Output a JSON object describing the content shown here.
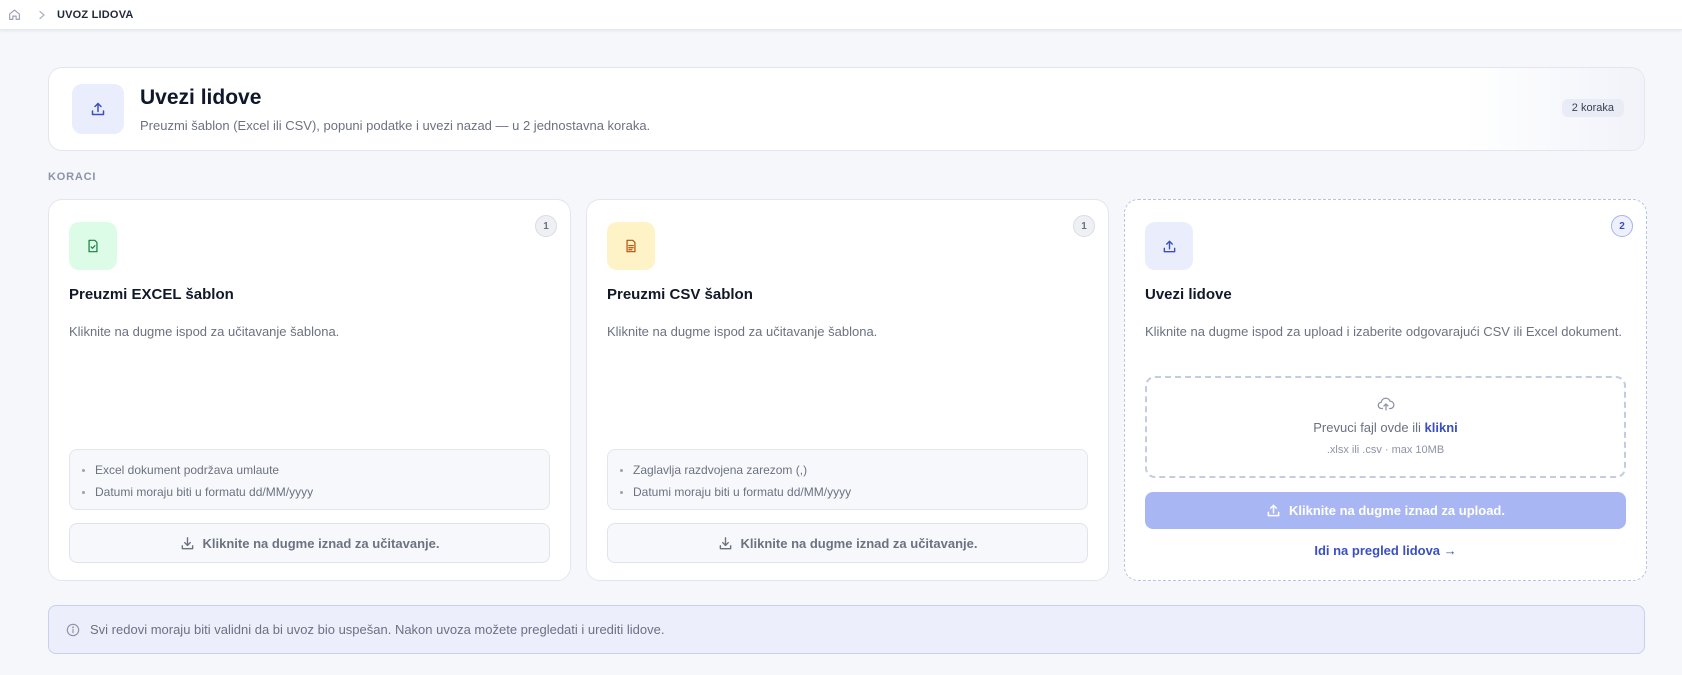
{
  "breadcrumb": {
    "home_icon": "home-icon",
    "separator_icon": "chevron-right-icon",
    "current": "UVOZ LIDOVA"
  },
  "hero": {
    "icon": "upload-icon",
    "title": "Uvezi lidove",
    "subtitle": "Preuzmi šablon (Excel ili CSV), popuni podatke i uvezi nazad — u 2 jednostavna koraka.",
    "badge": "2 koraka"
  },
  "section_label": "KORACI",
  "cards": [
    {
      "step": "1",
      "icon": "file-check-icon",
      "title": "Preuzmi EXCEL šablon",
      "description": "Kliknite na dugme ispod za učitavanje šablona.",
      "notes": [
        "Excel dokument podržava umlaute",
        "Datumi moraju biti u formatu dd/MM/yyyy"
      ],
      "button": "Kliknite na dugme iznad za učitavanje."
    },
    {
      "step": "1",
      "icon": "file-text-icon",
      "title": "Preuzmi CSV šablon",
      "description": "Kliknite na dugme ispod za učitavanje šablona.",
      "notes": [
        "Zaglavlja razdvojena zarezom (,)",
        "Datumi moraju biti u formatu dd/MM/yyyy"
      ],
      "button": "Kliknite na dugme iznad za učitavanje."
    },
    {
      "step": "2",
      "icon": "upload-icon",
      "title": "Uvezi lidove",
      "description": "Kliknite na dugme ispod za upload i izaberite odgovarajući CSV ili Excel dokument.",
      "dropzone": {
        "icon": "cloud-upload-icon",
        "text": "Prevuci fajl ovde ili",
        "link": "klikni",
        "hint": ".xlsx ili .csv · max 10MB"
      },
      "upload_button": "Kliknite na dugme iznad za upload.",
      "goto_link": "Idi na pregled lidova →"
    }
  ],
  "info": {
    "icon": "info-icon",
    "text": "Svi redovi moraju biti validni da bi uvoz bio uspešan. Nakon uvoza možete pregledati i urediti lidove."
  },
  "colors": {
    "accent": "#3b4fc4",
    "upload_button_disabled": "#a9b6f4",
    "excel_icon_bg": "#dcfce7",
    "csv_icon_bg": "#fef3c7"
  }
}
